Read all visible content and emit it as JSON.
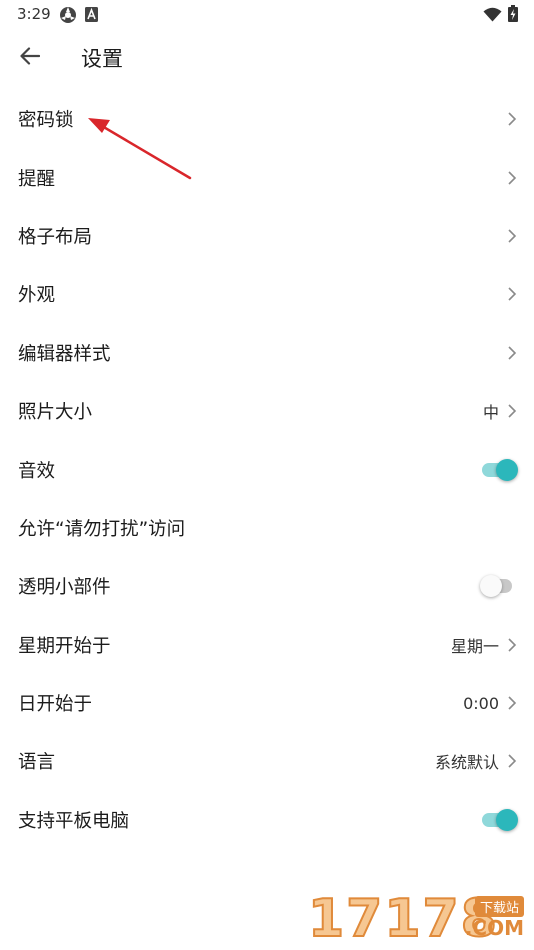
{
  "status_bar": {
    "time": "3:29",
    "icons": [
      "settings-sync-icon",
      "a-badge-icon",
      "wifi-icon",
      "battery-charging-icon"
    ]
  },
  "header": {
    "title": "设置",
    "back_icon": "arrow-left-icon"
  },
  "settings": [
    {
      "label": "密码锁",
      "type": "nav",
      "value": ""
    },
    {
      "label": "提醒",
      "type": "nav",
      "value": ""
    },
    {
      "label": "格子布局",
      "type": "nav",
      "value": ""
    },
    {
      "label": "外观",
      "type": "nav",
      "value": ""
    },
    {
      "label": "编辑器样式",
      "type": "nav",
      "value": ""
    },
    {
      "label": "照片大小",
      "type": "nav",
      "value": "中"
    },
    {
      "label": "音效",
      "type": "toggle",
      "on": true
    },
    {
      "label": "允许“请勿打扰”访问",
      "type": "plain"
    },
    {
      "label": "透明小部件",
      "type": "toggle",
      "on": false
    },
    {
      "label": "星期开始于",
      "type": "nav",
      "value": "星期一"
    },
    {
      "label": "日开始于",
      "type": "nav",
      "value": "0:00"
    },
    {
      "label": "语言",
      "type": "nav",
      "value": "系统默认"
    },
    {
      "label": "支持平板电脑",
      "type": "toggle",
      "on": true
    }
  ],
  "colors": {
    "accent": "#2cb7bb",
    "accent_track": "#8fd8da",
    "annotation_arrow": "#d9262b",
    "watermark": "#e08a3a"
  },
  "watermark": {
    "digits": "17178",
    "badge": "下载站",
    "domain": ".COM"
  }
}
